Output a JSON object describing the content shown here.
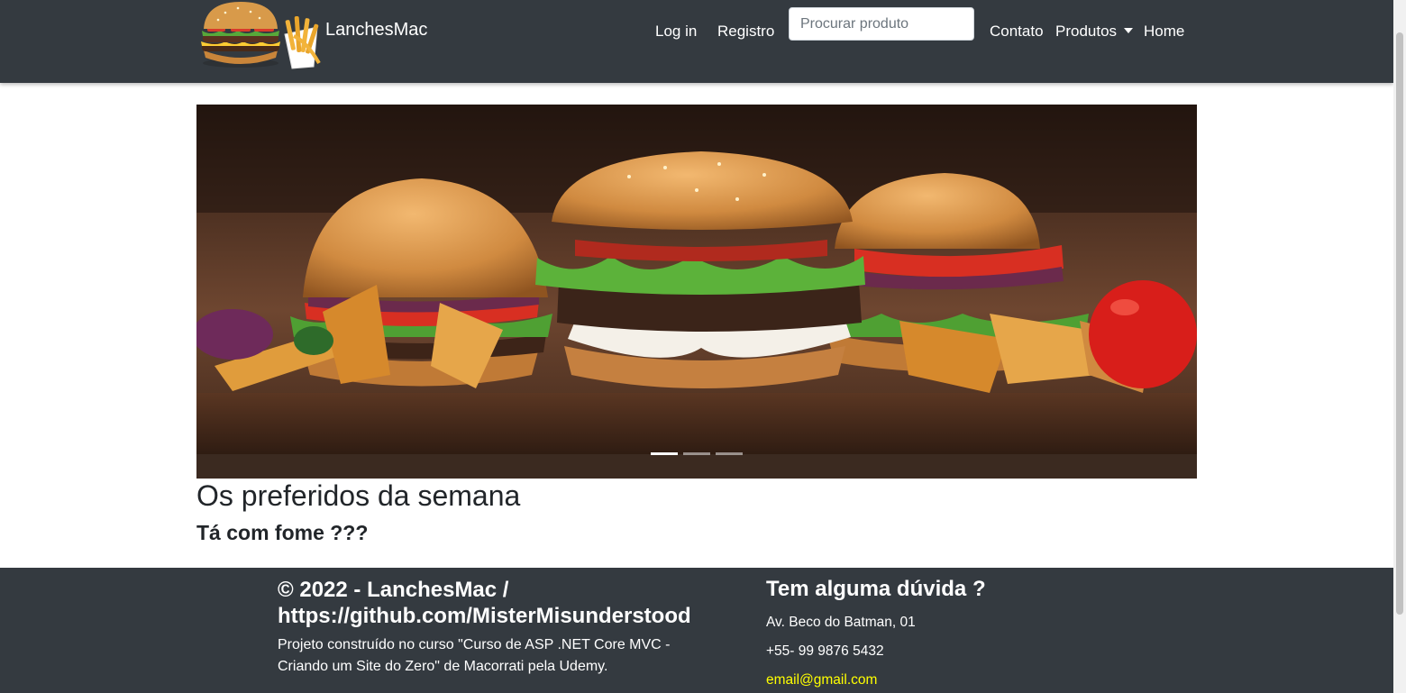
{
  "navbar": {
    "brand": "LanchesMac",
    "login": "Log in",
    "register": "Registro",
    "search_placeholder": "Procurar produto",
    "contact": "Contato",
    "products": "Produtos",
    "home": "Home"
  },
  "carousel": {
    "slides": 3,
    "active_slide": 1
  },
  "main": {
    "heading": "Os preferidos da semana",
    "subheading": "Tá com fome ???"
  },
  "footer": {
    "copyright": "© 2022 - LanchesMac / https://github.com/MisterMisunderstood",
    "description": "Projeto construído no curso \"Curso de ASP .NET Core MVC - Criando um Site do Zero\" de Macorrati pela Udemy.",
    "question": "Tem alguma dúvida ?",
    "address": "Av. Beco do Batman, 01",
    "phone": "+55- 99 9876 5432",
    "email": "email@gmail.com"
  },
  "colors": {
    "navbar_bg": "#343a40",
    "footer_bg": "#343a40",
    "email_link": "#ffff00"
  },
  "icons": {
    "logo": "burger-and-fries-logo",
    "dropdown": "caret-down-icon"
  }
}
